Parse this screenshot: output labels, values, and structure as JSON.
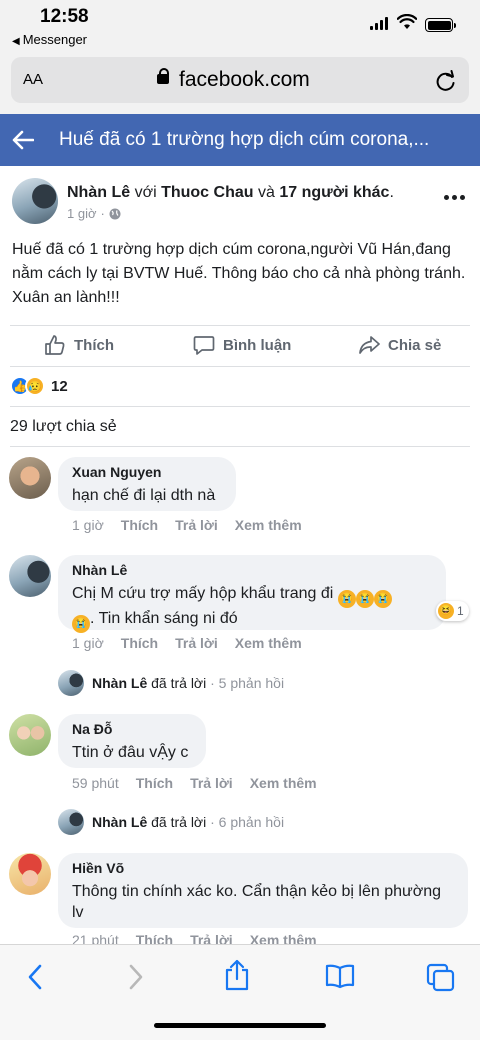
{
  "status": {
    "time": "12:58",
    "back_app": "Messenger"
  },
  "browser": {
    "aa": "AA",
    "domain": "facebook.com"
  },
  "header": {
    "title": "Huế đã có 1 trường hợp dịch cúm corona,..."
  },
  "post": {
    "author": "Nhàn Lê",
    "with_word": "với",
    "tagged": "Thuoc Chau",
    "and_word": "và",
    "others": "17 người khác",
    "time": "1 giờ",
    "privacy_icon": "globe-icon",
    "text": "Huế đã có 1 trường hợp dịch cúm corona,người Vũ Hán,đang nằm cách ly tại BVTW Huế. Thông báo cho cả nhà phòng tránh. Xuân an lành!!!",
    "actions": {
      "like": "Thích",
      "comment": "Bình luận",
      "share": "Chia sẻ"
    },
    "reaction_count": "12",
    "shares": "29 lượt chia sẻ"
  },
  "comments": [
    {
      "name": "Xuan Nguyen",
      "text": "hạn chế đi lại dth nà",
      "time": "1 giờ",
      "like": "Thích",
      "reply": "Trả lời",
      "more": "Xem thêm"
    },
    {
      "name": "Nhàn Lê",
      "text": "Chị M cứu trợ mấy hộp khẩu trang đi",
      "text2": ". Tin khẩn sáng ni đó",
      "time": "1 giờ",
      "like": "Thích",
      "reply": "Trả lời",
      "more": "Xem thêm",
      "reaction_count": "1",
      "replies": {
        "name": "Nhàn Lê",
        "verb": "đã trả lời",
        "sep": "·",
        "count": "5 phản hồi"
      }
    },
    {
      "name": "Na Đỗ",
      "text": "Ttin ở đâu vẬy c",
      "time": "59 phút",
      "like": "Thích",
      "reply": "Trả lời",
      "more": "Xem thêm",
      "replies": {
        "name": "Nhàn Lê",
        "verb": "đã trả lời",
        "sep": "·",
        "count": "6 phản hồi"
      }
    },
    {
      "name": "Hiền Võ",
      "text": "Thông tin chính xác ko. Cẩn thận kẻo bị lên phường lv",
      "time": "21 phút",
      "like": "Thích",
      "reply": "Trả lời",
      "more": "Xem thêm"
    }
  ],
  "colors": {
    "fb_blue": "#4267b2",
    "ios_blue": "#1877f2"
  }
}
